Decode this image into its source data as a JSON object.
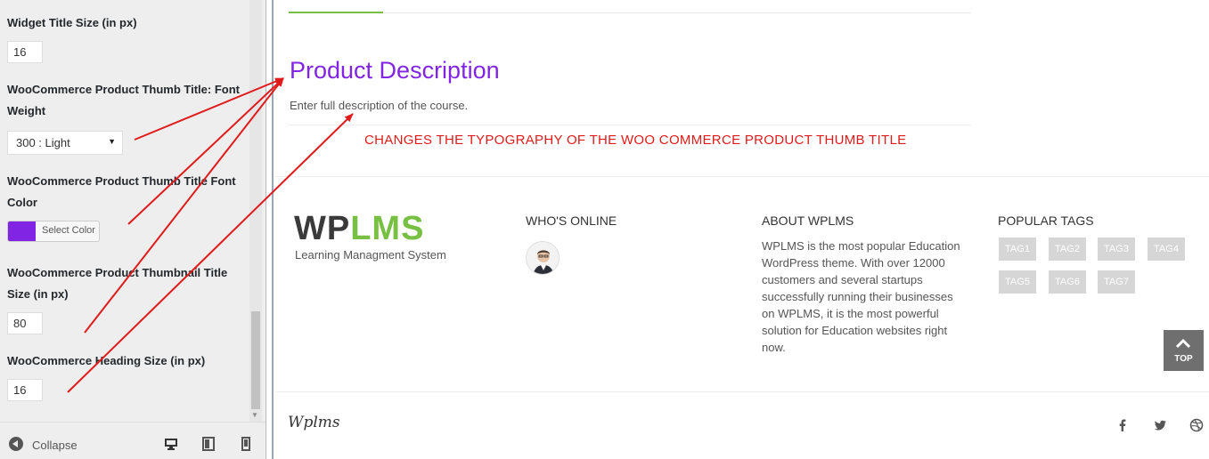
{
  "sidebar": {
    "widget_title_size": {
      "label": "Widget Title Size (in px)",
      "value": "16"
    },
    "thumb_font_weight": {
      "label": "WooCommerce Product Thumb Title: Font Weight",
      "selected": "300 : Light"
    },
    "thumb_font_color": {
      "label": "WooCommerce Product Thumb Title Font Color",
      "button_label": "Select Color",
      "swatch_color": "#8224e3"
    },
    "thumbnail_title_size": {
      "label": "WooCommerce Product Thumbnail Title Size (in px)",
      "value": "80"
    },
    "heading_size": {
      "label": "WooCommerce Heading Size (in px)",
      "value": "16"
    },
    "footer": {
      "collapse_label": "Collapse",
      "devices": [
        "desktop-icon",
        "tablet-icon",
        "mobile-icon"
      ]
    }
  },
  "preview": {
    "product_title": "Product Description",
    "product_description": "Enter full description of the course.",
    "annotation": "CHANGES THE TYPOGRAPHY OF THE WOO COMMERCE PRODUCT THUMB TITLE",
    "annotation_color": "#e01b1b",
    "accent_color": "#8224e3",
    "logo": {
      "part1": "WP",
      "part2": "LMS",
      "subtitle": "Learning Managment System"
    },
    "whos_online_title": "WHO'S ONLINE",
    "about_title": "ABOUT WPLMS",
    "about_text": "WPLMS is the most popular Education WordPress theme. With over 12000 customers and several startups successfully running their businesses on WPLMS, it is the most powerful solution for Education websites right now.",
    "tags_title": "POPULAR TAGS",
    "tags": [
      "TAG1",
      "TAG2",
      "TAG3",
      "TAG4",
      "TAG5",
      "TAG6",
      "TAG7"
    ],
    "top_button": "TOP",
    "footer_logo": "Wplms",
    "social": [
      "facebook-icon",
      "twitter-icon",
      "dribbble-icon"
    ]
  }
}
